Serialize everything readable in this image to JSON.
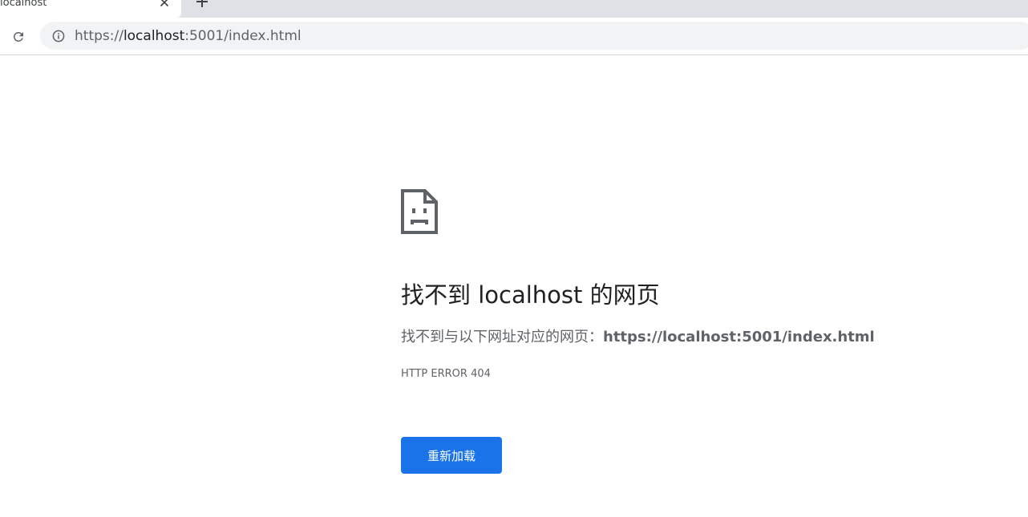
{
  "tab": {
    "title": "localhost",
    "close_icon": "close-icon"
  },
  "new_tab_icon": "plus-icon",
  "toolbar": {
    "reload_icon": "reload-icon",
    "info_icon": "info-icon",
    "url_scheme": "https://",
    "url_host": "localhost",
    "url_rest": ":5001/index.html"
  },
  "error_page": {
    "icon": "sad-page-icon",
    "heading": "找不到 localhost 的网页",
    "description_prefix": "找不到与以下网址对应的网页：",
    "description_url": "https://localhost:5001/index.html",
    "error_code": "HTTP ERROR 404",
    "reload_label": "重新加载"
  },
  "colors": {
    "accent": "#1a73e8",
    "tabstrip": "#dee1e6",
    "omnibox": "#f1f3f4",
    "text_primary": "#202124",
    "text_secondary": "#5f6368"
  }
}
